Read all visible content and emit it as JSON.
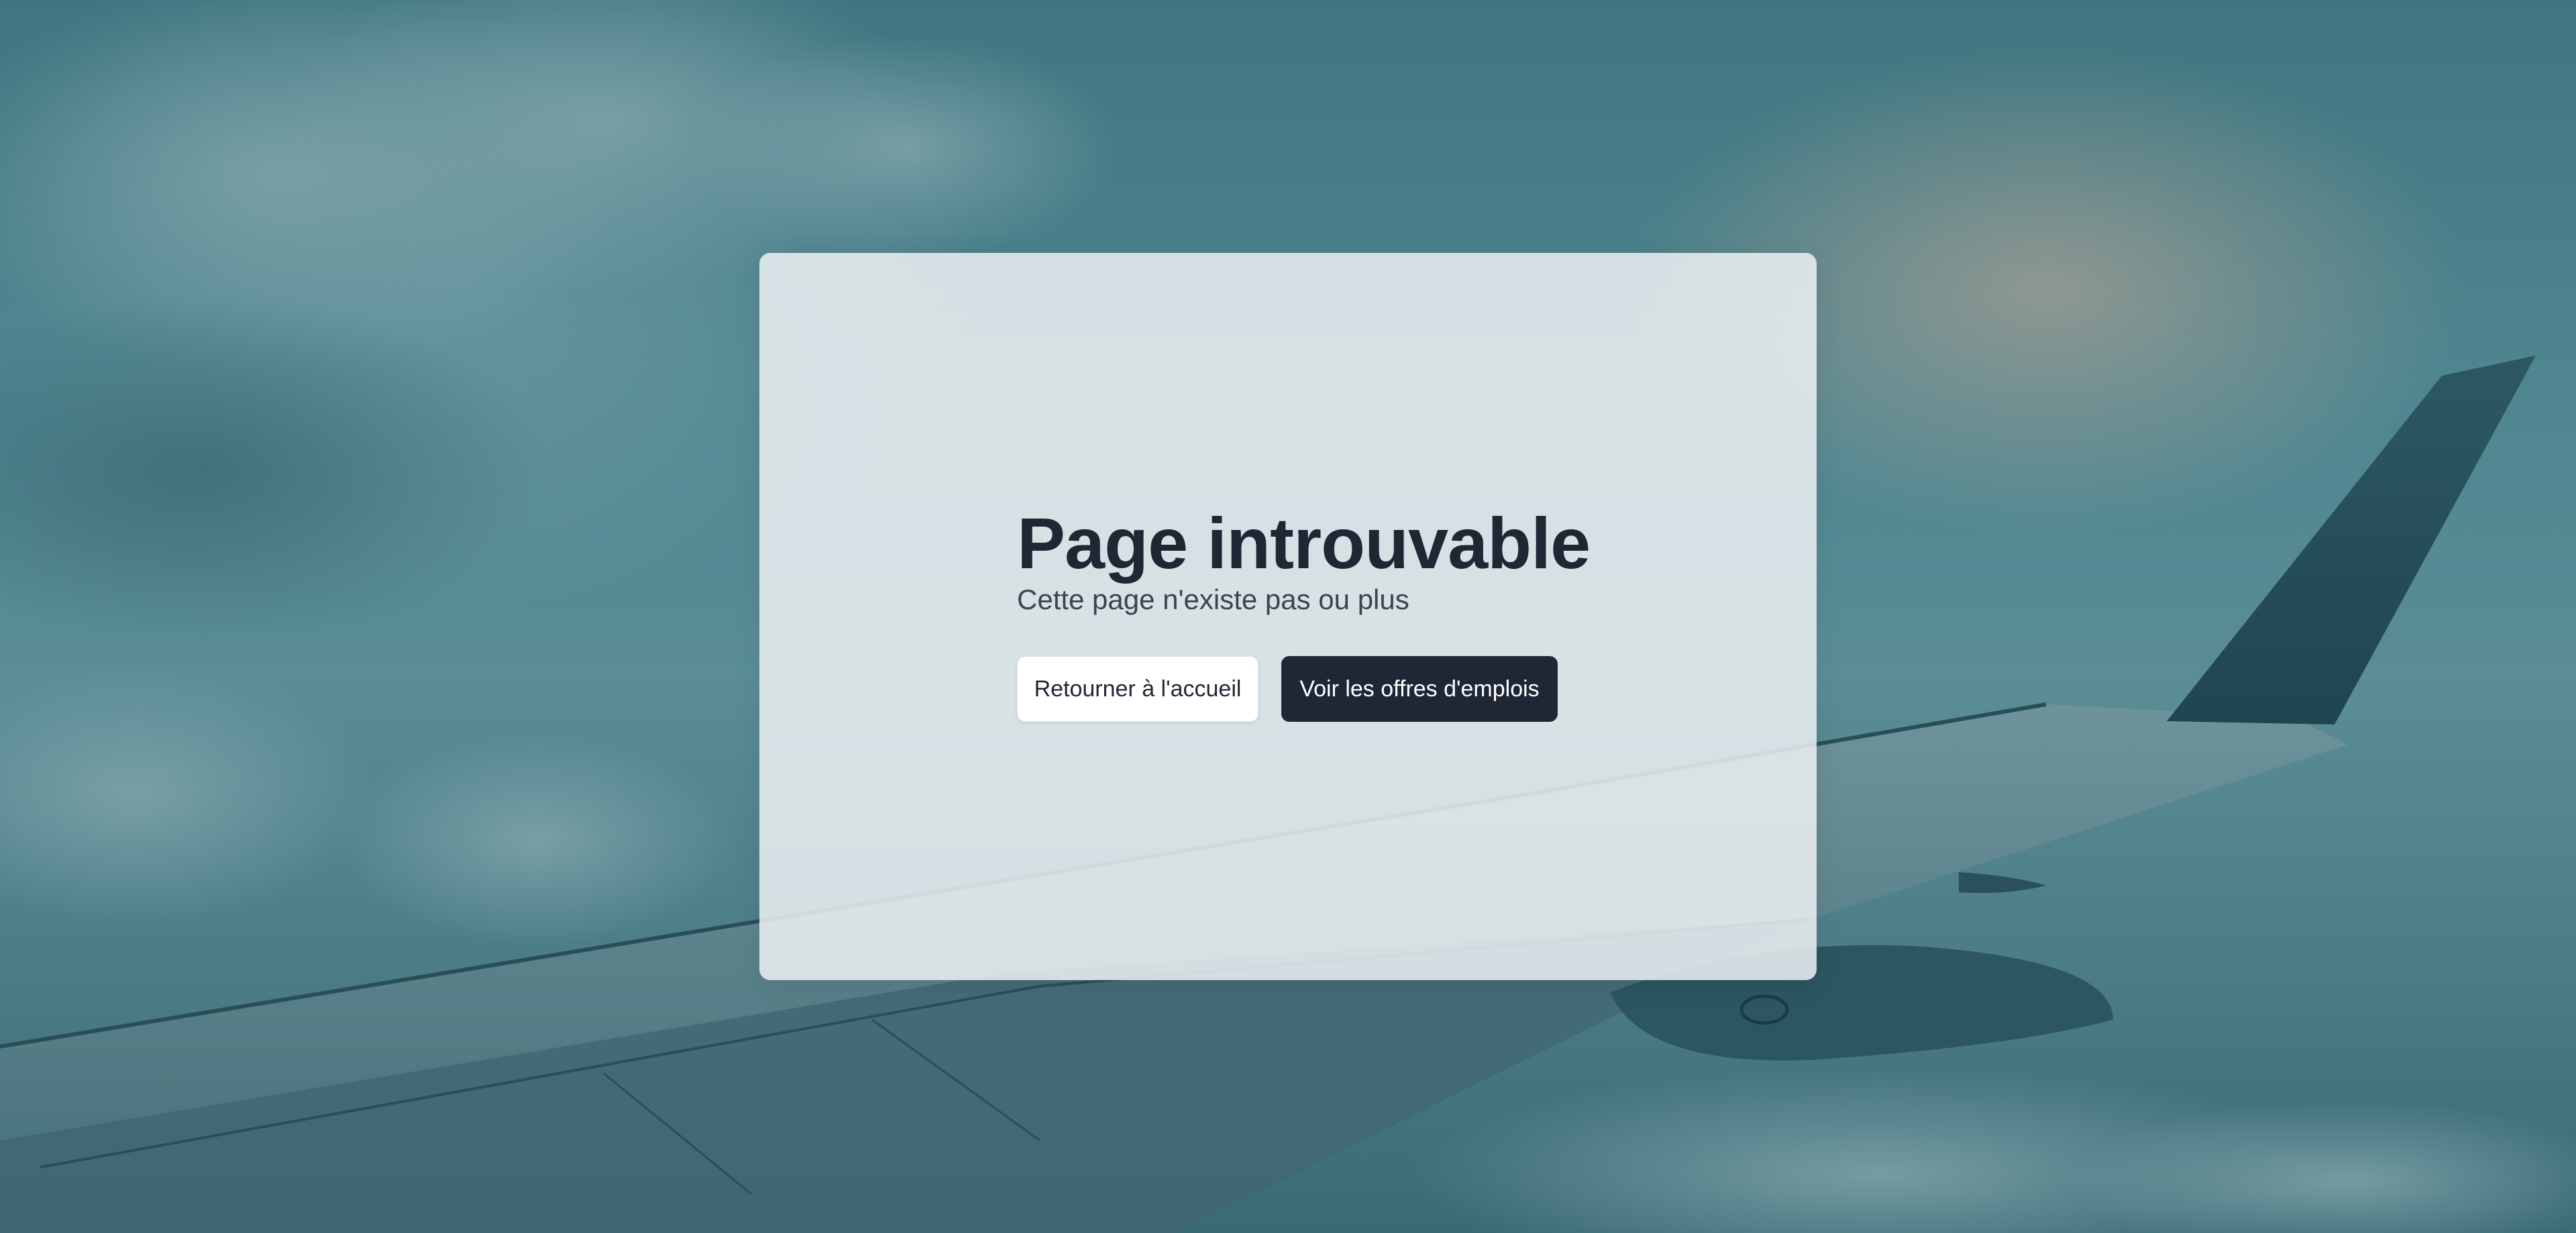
{
  "error": {
    "title": "Page introuvable",
    "subtitle": "Cette page n'existe pas ou plus"
  },
  "actions": {
    "home_label": "Retourner à l'accueil",
    "jobs_label": "Voir les offres d'emplois"
  },
  "colors": {
    "background": "#4e858f",
    "card": "#eceff2",
    "text_dark": "#1f2634",
    "button_dark": "#1f2634",
    "button_light": "#ffffff"
  },
  "background_image": "airplane-wing-above-clouds"
}
